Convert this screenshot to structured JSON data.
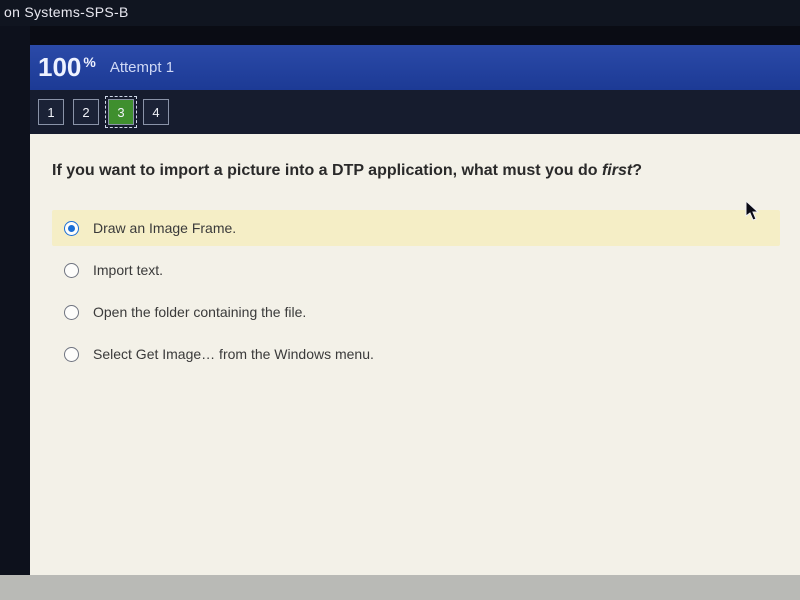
{
  "window": {
    "title": "on Systems-SPS-B"
  },
  "header": {
    "score_value": "100",
    "score_unit": "%",
    "attempt_label": "Attempt 1"
  },
  "qnav": {
    "items": [
      {
        "label": "1",
        "active": false
      },
      {
        "label": "2",
        "active": false
      },
      {
        "label": "3",
        "active": true
      },
      {
        "label": "4",
        "active": false
      }
    ]
  },
  "question": {
    "prefix": "If you want to import a picture into a DTP application, what must you do ",
    "emph": "first",
    "suffix": "?"
  },
  "options": [
    {
      "label": "Draw an Image Frame.",
      "selected": true
    },
    {
      "label": "Import text.",
      "selected": false
    },
    {
      "label": "Open the folder containing the file.",
      "selected": false
    },
    {
      "label": "Select Get Image… from the Windows menu.",
      "selected": false
    }
  ]
}
